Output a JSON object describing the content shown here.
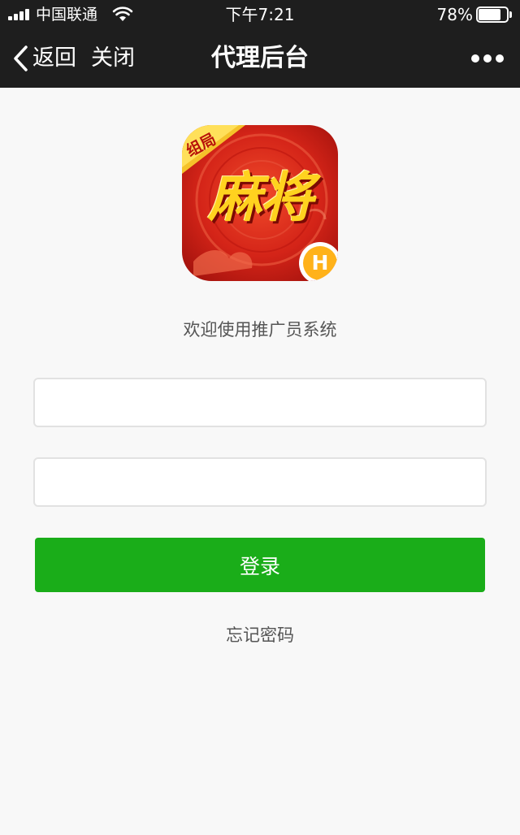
{
  "status_bar": {
    "carrier": "中国联通",
    "time": "下午7:21",
    "battery_percent": "78%",
    "battery_level": 0.78
  },
  "nav": {
    "back_label": "返回",
    "close_label": "关闭",
    "title": "代理后台"
  },
  "logo": {
    "badge_text": "组局",
    "title_text": "麻将",
    "corner_letter": "H"
  },
  "welcome_text": "欢迎使用推广员系统",
  "form": {
    "username_value": "",
    "password_value": "",
    "login_label": "登录",
    "forgot_label": "忘记密码"
  },
  "colors": {
    "bar_bg": "#1e1e1e",
    "page_bg": "#f8f8f8",
    "primary_green": "#1aad19"
  }
}
